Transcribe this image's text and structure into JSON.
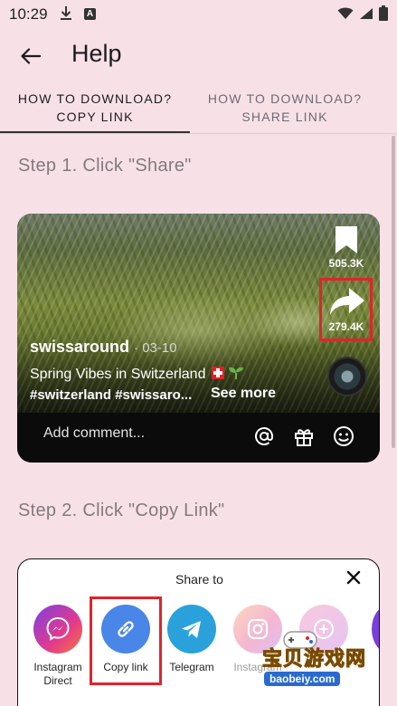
{
  "status_bar": {
    "time": "10:29"
  },
  "app_bar": {
    "title": "Help"
  },
  "tabs": [
    {
      "line1": "HOW TO DOWNLOAD?",
      "line2": "COPY LINK",
      "selected": true
    },
    {
      "line1": "HOW TO DOWNLOAD?",
      "line2": "SHARE LINK",
      "selected": false
    }
  ],
  "steps": {
    "step1": "Step 1. Click \"Share\"",
    "step2": "Step 2. Click \"Copy Link\""
  },
  "video_post": {
    "bookmark_count": "505.3K",
    "share_count": "279.4K",
    "author": "swissaround",
    "date": "· 03-10",
    "caption": "Spring Vibes in Switzerland",
    "hashtags": "#switzerland #swissaro...",
    "see_more": "See more",
    "comment_placeholder": "Add comment..."
  },
  "share_sheet": {
    "title": "Share to",
    "apps": [
      {
        "label": "Instagram Direct",
        "icon": "messenger-icon"
      },
      {
        "label": "Copy link",
        "icon": "link-icon"
      },
      {
        "label": "Telegram",
        "icon": "telegram-icon"
      },
      {
        "label": "Instagram",
        "icon": "instagram-icon"
      },
      {
        "label": "",
        "icon": "plus-icon"
      }
    ]
  },
  "watermark": {
    "text": "宝贝游戏网",
    "url": "baobeiy.com"
  },
  "colors": {
    "background": "#f7e1e7",
    "highlight": "#e0242c",
    "copy_link_blue": "#4a86e8",
    "telegram_blue": "#2aa1db"
  }
}
